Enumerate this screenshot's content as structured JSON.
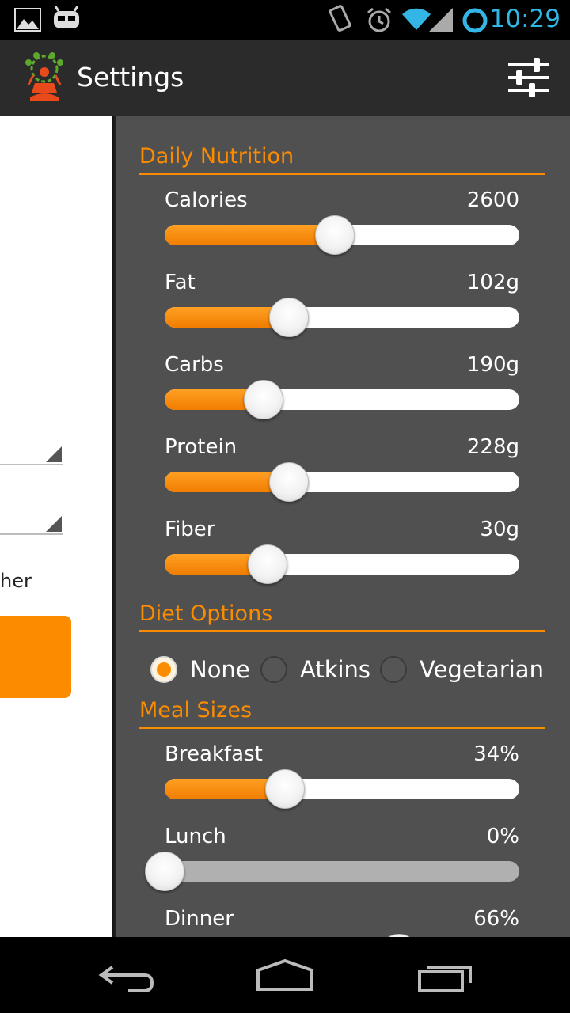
{
  "status_bar": {
    "time": "10:29",
    "icons": [
      "image-icon",
      "cyanogen-icon",
      "vibrate-icon",
      "alarm-icon",
      "wifi-icon",
      "signal-icon",
      "battery-ring-icon"
    ]
  },
  "action_bar": {
    "title": "Settings",
    "icons": [
      "app-logo-icon",
      "tune-icon"
    ]
  },
  "left_panel": {
    "partial_text": "her"
  },
  "colors": {
    "accent": "#fb8c00",
    "drawer_bg": "#505050",
    "clock": "#33b5e5"
  },
  "daily_nutrition": {
    "title": "Daily Nutrition",
    "items": [
      {
        "label": "Calories",
        "value": "2600",
        "fraction": 0.48
      },
      {
        "label": "Fat",
        "value": "102g",
        "fraction": 0.35
      },
      {
        "label": "Carbs",
        "value": "190g",
        "fraction": 0.28
      },
      {
        "label": "Protein",
        "value": "228g",
        "fraction": 0.35
      },
      {
        "label": "Fiber",
        "value": "30g",
        "fraction": 0.29
      }
    ]
  },
  "diet_options": {
    "title": "Diet Options",
    "options": [
      "None",
      "Atkins",
      "Vegetarian"
    ],
    "selected": "None"
  },
  "meal_sizes": {
    "title": "Meal Sizes",
    "items": [
      {
        "label": "Breakfast",
        "value": "34%",
        "fraction": 0.34
      },
      {
        "label": "Lunch",
        "value": "0%",
        "fraction": 0.0
      },
      {
        "label": "Dinner",
        "value": "66%",
        "fraction": 0.66
      }
    ]
  },
  "nav_bar": {
    "icons": [
      "back-icon",
      "home-icon",
      "recents-icon"
    ]
  }
}
